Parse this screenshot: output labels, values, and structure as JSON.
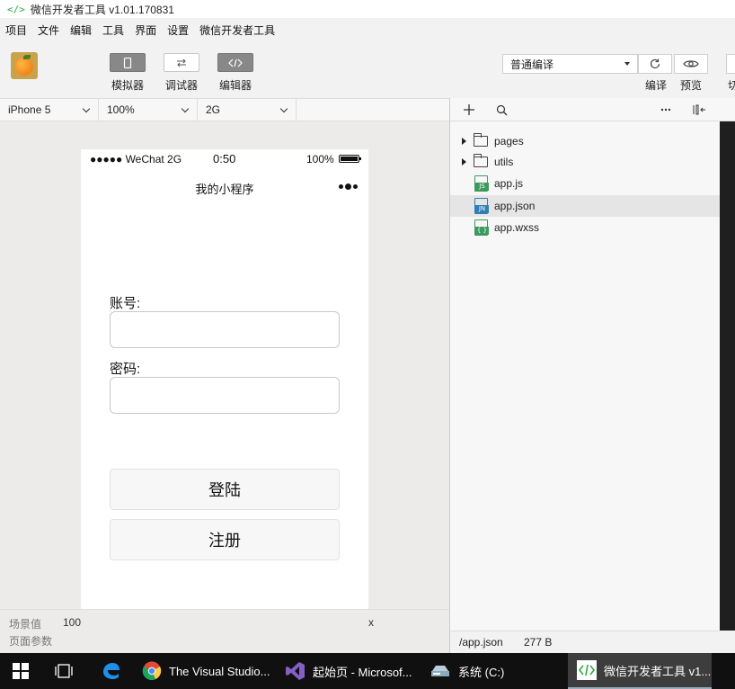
{
  "window": {
    "title": "微信开发者工具 v1.01.170831",
    "logo_glyph": "</>"
  },
  "menu": {
    "items": [
      "项目",
      "文件",
      "编辑",
      "工具",
      "界面",
      "设置",
      "微信开发者工具"
    ]
  },
  "toolbar": {
    "simulator_label": "模拟器",
    "debugger_label": "调试器",
    "editor_label": "编辑器",
    "compile_mode": "普通编译",
    "compile_label": "编译",
    "preview_label": "预览",
    "cut_label": "切"
  },
  "subbar": {
    "device": "iPhone 5",
    "zoom": "100%",
    "network": "2G"
  },
  "phone": {
    "carrier": "●●●●● WeChat 2G",
    "time": "0:50",
    "battery_text": "100%",
    "nav_title": "我的小程序",
    "account_label": "账号:",
    "account_value": "",
    "password_label": "密码:",
    "password_value": "",
    "login_label": "登陆",
    "register_label": "注册"
  },
  "bottom_info": {
    "scene_label": "场景值",
    "scene_value": "100",
    "page_params_label": "页面参数",
    "trailing": "x"
  },
  "explorer": {
    "items": [
      {
        "name": "pages",
        "type": "folder"
      },
      {
        "name": "utils",
        "type": "folder"
      },
      {
        "name": "app.js",
        "type": "file",
        "tag": "JS",
        "color": "#3c9a5f"
      },
      {
        "name": "app.json",
        "type": "file",
        "tag": "JN",
        "color": "#2f7fb5",
        "selected": true
      },
      {
        "name": "app.wxss",
        "type": "file",
        "tag": "{ }",
        "color": "#3c9a5f"
      }
    ],
    "status_path": "/app.json",
    "status_size": "277 B"
  },
  "taskbar": {
    "items": [
      {
        "label": "The Visual Studio...",
        "icon": "chrome-icon"
      },
      {
        "label": "起始页 - Microsof...",
        "icon": "visual-studio-icon"
      },
      {
        "label": "系统 (C:)",
        "icon": "drive-icon"
      },
      {
        "label": "微信开发者工具 v1...",
        "icon": "wechat-devtools-icon",
        "active": true
      }
    ]
  },
  "colors": {
    "accent_green": "#2faa43",
    "taskbar_bg": "#101010",
    "editor_bg": "#1f1f1f"
  }
}
